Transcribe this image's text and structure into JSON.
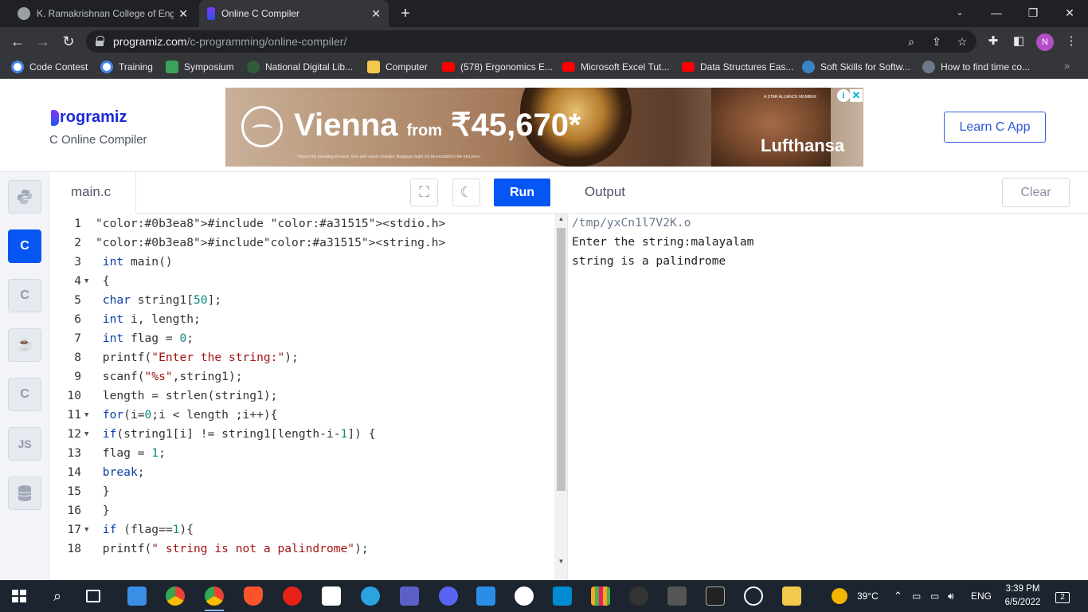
{
  "browser": {
    "tabs": [
      {
        "title": "K. Ramakrishnan College of Engir",
        "active": false
      },
      {
        "title": "Online C Compiler",
        "active": true
      }
    ],
    "new_tab_label": "+",
    "url_host": "programiz.com",
    "url_path": "/c-programming/online-compiler/",
    "profile_initial": "N",
    "bookmarks": [
      {
        "label": "Code Contest",
        "icon": "google-icon",
        "color": "#4285f4"
      },
      {
        "label": "Training",
        "icon": "google-icon",
        "color": "#4285f4"
      },
      {
        "label": "Symposium",
        "icon": "kf-icon",
        "color": "#3aa35a"
      },
      {
        "label": "National Digital Lib...",
        "icon": "ndl-icon",
        "color": "#2f5d3a"
      },
      {
        "label": "Computer",
        "icon": "folder-icon",
        "color": "#f2c94c"
      },
      {
        "label": "(578) Ergonomics E...",
        "icon": "youtube-icon",
        "color": "#ff0000"
      },
      {
        "label": "Microsoft Excel Tut...",
        "icon": "youtube-icon",
        "color": "#ff0000"
      },
      {
        "label": "Data Structures Eas...",
        "icon": "youtube-icon",
        "color": "#ff0000"
      },
      {
        "label": "Soft Skills for Softw...",
        "icon": "globe-icon",
        "color": "#3b82c4"
      },
      {
        "label": "How to find time co...",
        "icon": "site-icon",
        "color": "#6b7a8a"
      }
    ]
  },
  "site": {
    "logo_text": "rogramiz",
    "subtitle": "C Online Compiler",
    "learn_button": "Learn C App",
    "ad": {
      "headline": "Vienna",
      "from": "from",
      "price": "₹45,670*",
      "brand": "Lufthansa",
      "fine_print": "* Round trip including all taxes, fees and carrier charges. Baggage might not be included in the end price.",
      "member": "A STAR ALLIANCE MEMBER",
      "info": "i",
      "close": "✕"
    }
  },
  "languages": [
    {
      "name": "python-lang",
      "label": "",
      "active": false
    },
    {
      "name": "c-lang",
      "label": "C",
      "active": true
    },
    {
      "name": "cpp-lang",
      "label": "C",
      "active": false
    },
    {
      "name": "java-lang",
      "label": "",
      "active": false
    },
    {
      "name": "csharp-lang",
      "label": "C",
      "active": false
    },
    {
      "name": "js-lang",
      "label": "JS",
      "active": false
    },
    {
      "name": "sql-lang",
      "label": "",
      "active": false
    }
  ],
  "editor": {
    "file_name": "main.c",
    "run_label": "Run",
    "lines": [
      {
        "n": "1",
        "fold": false,
        "code": "#include <stdio.h>"
      },
      {
        "n": "2",
        "fold": false,
        "code": "#include<string.h>"
      },
      {
        "n": "3",
        "fold": false,
        "code": " int main()"
      },
      {
        "n": "4",
        "fold": true,
        "code": " {"
      },
      {
        "n": "5",
        "fold": false,
        "code": " char string1[50];"
      },
      {
        "n": "6",
        "fold": false,
        "code": " int i, length;"
      },
      {
        "n": "7",
        "fold": false,
        "code": " int flag = 0;"
      },
      {
        "n": "8",
        "fold": false,
        "code": " printf(\"Enter the string:\");"
      },
      {
        "n": "9",
        "fold": false,
        "code": " scanf(\"%s\",string1);"
      },
      {
        "n": "10",
        "fold": false,
        "code": " length = strlen(string1);"
      },
      {
        "n": "11",
        "fold": true,
        "code": " for(i=0;i < length ;i++){"
      },
      {
        "n": "12",
        "fold": true,
        "code": " if(string1[i] != string1[length-i-1]) {"
      },
      {
        "n": "13",
        "fold": false,
        "code": " flag = 1;"
      },
      {
        "n": "14",
        "fold": false,
        "code": " break;"
      },
      {
        "n": "15",
        "fold": false,
        "code": " }"
      },
      {
        "n": "16",
        "fold": false,
        "code": " }"
      },
      {
        "n": "17",
        "fold": true,
        "code": " if (flag==1){"
      },
      {
        "n": "18",
        "fold": false,
        "code": " printf(\" string is not a palindrome\");"
      }
    ]
  },
  "output": {
    "title": "Output",
    "clear_label": "Clear",
    "lines": [
      "/tmp/yxCn1l7V2K.o",
      "Enter the string:malayalam",
      "string is a palindrome"
    ]
  },
  "taskbar": {
    "weather": "39°C",
    "language": "ENG",
    "time": "3:39 PM",
    "date": "6/5/2022",
    "notification_count": "2"
  }
}
